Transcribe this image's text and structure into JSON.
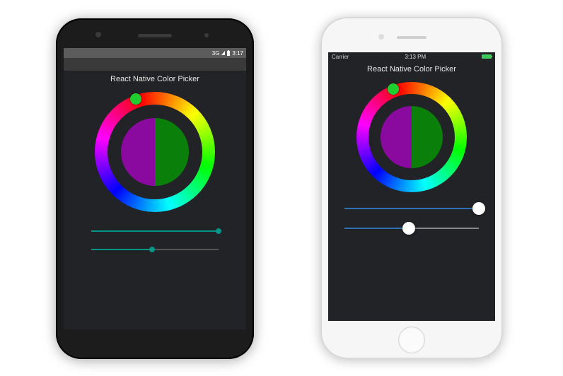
{
  "title": "React Native Color Picker",
  "android": {
    "status": {
      "time": "3:17",
      "network": "3G"
    },
    "hue_angle": 112,
    "old_color": "#8a0aa0",
    "new_color": "#0a7f0a",
    "sliders": {
      "saturation": 100,
      "value": 48
    },
    "slider_accent": "#009688"
  },
  "ios": {
    "status": {
      "carrier": "Carrier",
      "time": "3:13 PM"
    },
    "hue_angle": 112,
    "old_color": "#8a0aa0",
    "new_color": "#0a7f0a",
    "sliders": {
      "saturation": 100,
      "value": 48
    },
    "slider_active": "#2f6fb4"
  }
}
